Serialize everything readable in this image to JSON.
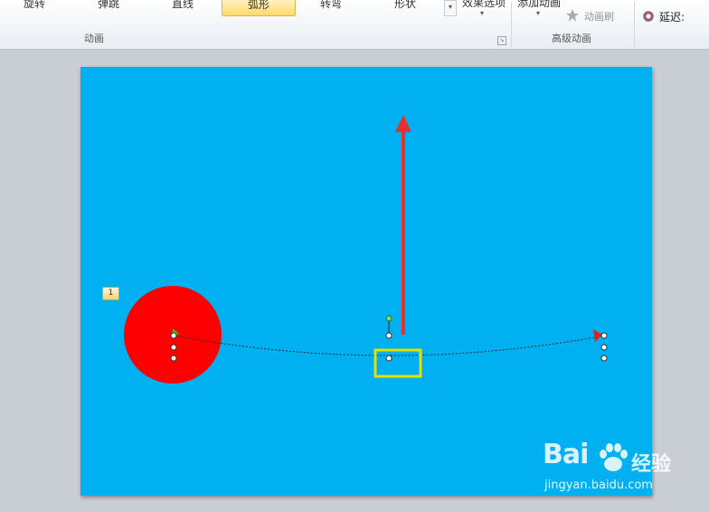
{
  "ribbon": {
    "animations_gallery": [
      "旋转",
      "弹跳",
      "直线",
      "弧形",
      "转弯",
      "形状"
    ],
    "selected_animation": "弧形",
    "effect_options_label": "效果选项",
    "animation_group_label": "动画",
    "add_animation_label": "添加动画",
    "animation_painter_label": "动画刷",
    "advanced_group_label": "高级动画",
    "delay_label": "延迟:"
  },
  "slide": {
    "background_color": "#00b0f0",
    "animation_tag": "1",
    "circle_color": "#ff0000",
    "arrow_color": "#e53030"
  },
  "watermark": {
    "brand": "Bai",
    "cn": "经验",
    "url": "jingyan.baidu.com"
  }
}
